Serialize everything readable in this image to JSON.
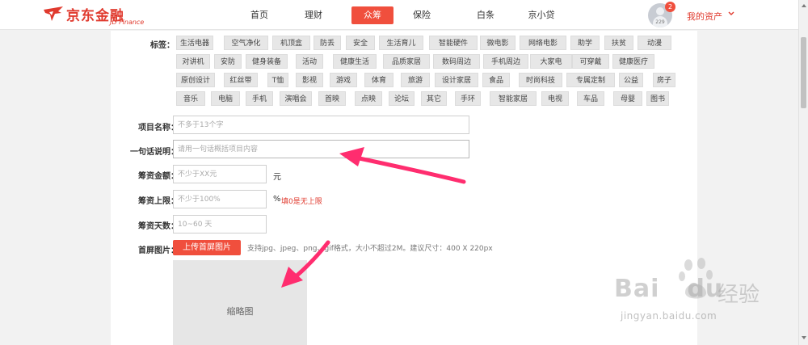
{
  "header": {
    "logo_cn": "京东金融",
    "logo_en": "JD Finance",
    "nav": [
      {
        "label": "首页",
        "active": false
      },
      {
        "label": "理财",
        "active": false
      },
      {
        "label": "众筹",
        "active": true
      },
      {
        "label": "保险",
        "active": false
      },
      {
        "label": "白条",
        "active": false
      },
      {
        "label": "京小贷",
        "active": false
      }
    ],
    "avatar_number": "229",
    "notification_count": "2",
    "my_assets": "我的资产",
    "brand_color": "#e03a2e",
    "accent_color": "#f04f3d"
  },
  "form": {
    "tags_label": "标签：",
    "tags": [
      [
        "生活电器",
        "空气净化",
        "机顶盒",
        "防丢",
        "安全",
        "生活育儿",
        "智能硬件",
        "微电影",
        "网络电影",
        "助学",
        "扶贫",
        "动漫"
      ],
      [
        "对讲机",
        "安防",
        "健身装备",
        "活动",
        "健康生活",
        "品质家居",
        "数码周边",
        "手机周边",
        "大家电",
        "可穿戴",
        "健康医疗"
      ],
      [
        "原创设计",
        "红丝带",
        "T恤",
        "影视",
        "游戏",
        "体育",
        "旅游",
        "设计家居",
        "食品",
        "时尚科技",
        "专属定制",
        "公益",
        "房子"
      ],
      [
        "音乐",
        "电脑",
        "手机",
        "演唱会",
        "首映",
        "点映",
        "论坛",
        "其它",
        "手环",
        "智能家居",
        "电视",
        "车品",
        "母婴",
        "图书"
      ]
    ],
    "project_name": {
      "label": "项目名称：",
      "placeholder": "不多于13个字"
    },
    "one_liner": {
      "label": "一句话说明：",
      "placeholder": "请用一句话概括项目内容"
    },
    "amount": {
      "label": "筹资金额：",
      "placeholder": "不少于XX元",
      "unit": "元"
    },
    "cap": {
      "label": "筹资上限：",
      "placeholder": "不少于100%",
      "unit": "%",
      "warning": "填0是无上限"
    },
    "days": {
      "label": "筹资天数：",
      "placeholder": "10~60 天"
    },
    "cover": {
      "label": "首屏图片：",
      "upload_label": "上传首屏图片",
      "hint": "支持jpg、jpeg、png、gif格式，大小不超过2M。建议尺寸：400 X 220px",
      "thumbnail_label": "缩略图"
    }
  },
  "watermark": {
    "brand": "Bai",
    "brand_tail": "du",
    "cn": "经验",
    "url": "jingyan.baidu.com"
  }
}
